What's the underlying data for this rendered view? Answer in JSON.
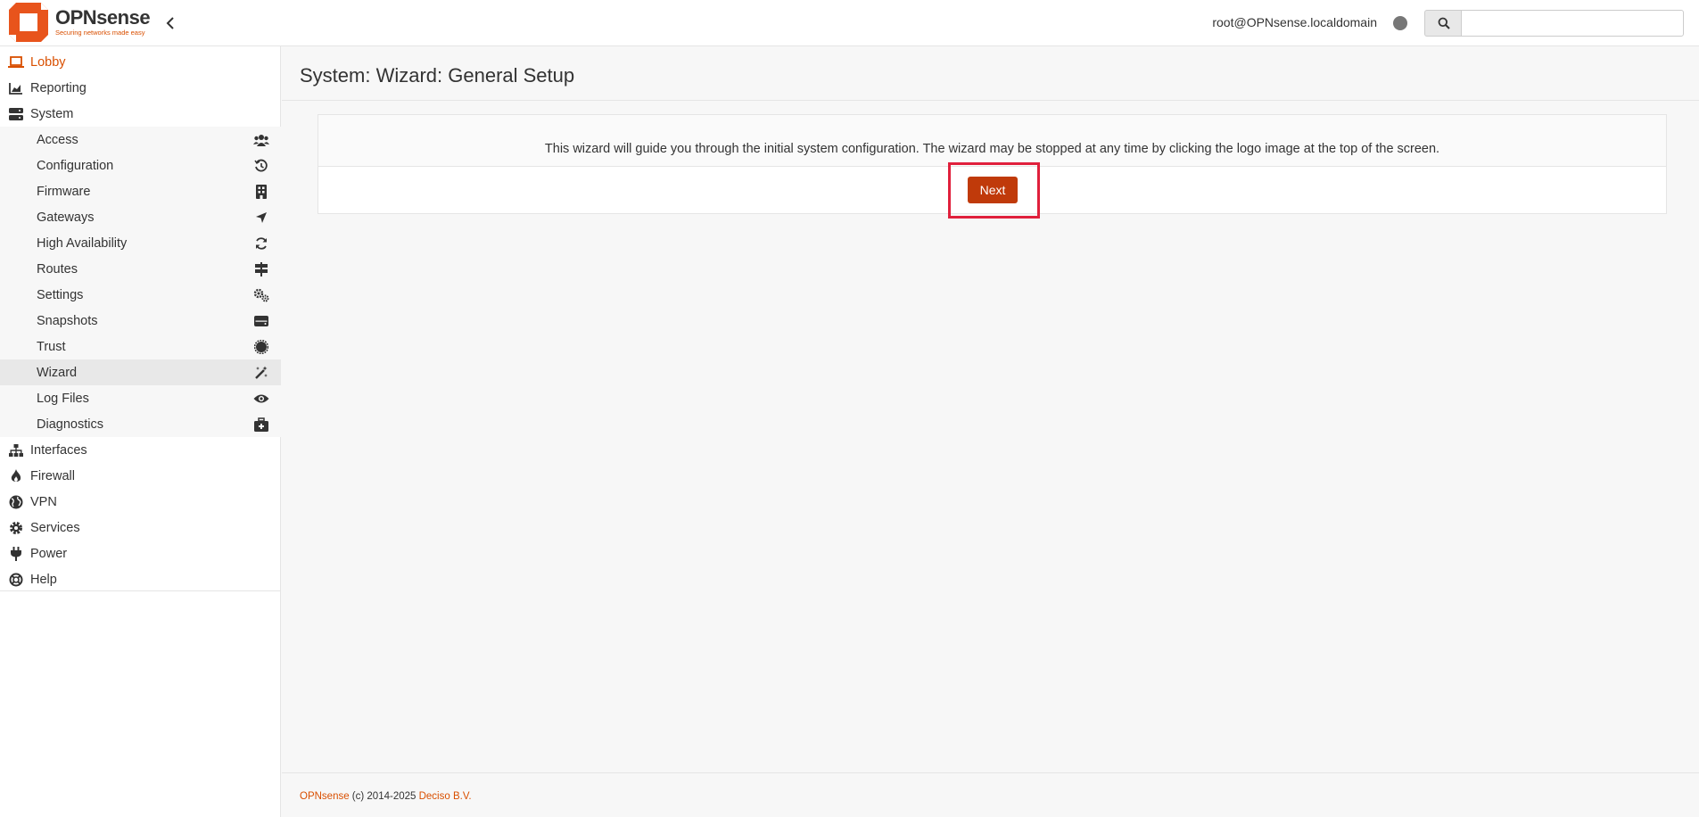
{
  "header": {
    "logo_name": "OPNsense",
    "logo_tagline": "Securing networks made easy",
    "user": "root@OPNsense.localdomain",
    "search_placeholder": ""
  },
  "sidebar": {
    "items": [
      {
        "label": "Lobby",
        "icon": "laptop-icon",
        "active": true
      },
      {
        "label": "Reporting",
        "icon": "area-chart-icon"
      },
      {
        "label": "System",
        "icon": "server-icon"
      },
      {
        "label": "Interfaces",
        "icon": "sitemap-icon"
      },
      {
        "label": "Firewall",
        "icon": "fire-icon"
      },
      {
        "label": "VPN",
        "icon": "globe-icon"
      },
      {
        "label": "Services",
        "icon": "gear-icon"
      },
      {
        "label": "Power",
        "icon": "plug-icon"
      },
      {
        "label": "Help",
        "icon": "life-ring-icon"
      }
    ],
    "system_sub": [
      {
        "label": "Access",
        "icon": "users-icon"
      },
      {
        "label": "Configuration",
        "icon": "history-icon"
      },
      {
        "label": "Firmware",
        "icon": "building-icon"
      },
      {
        "label": "Gateways",
        "icon": "location-arrow-icon"
      },
      {
        "label": "High Availability",
        "icon": "refresh-icon"
      },
      {
        "label": "Routes",
        "icon": "signpost-icon"
      },
      {
        "label": "Settings",
        "icon": "gears-icon"
      },
      {
        "label": "Snapshots",
        "icon": "hdd-icon"
      },
      {
        "label": "Trust",
        "icon": "certificate-icon"
      },
      {
        "label": "Wizard",
        "icon": "magic-wand-icon",
        "selected": true
      },
      {
        "label": "Log Files",
        "icon": "eye-icon"
      },
      {
        "label": "Diagnostics",
        "icon": "medkit-icon"
      }
    ]
  },
  "main": {
    "title": "System: Wizard: General Setup",
    "description": "This wizard will guide you through the initial system configuration. The wizard may be stopped at any time by clicking the logo image at the top of the screen.",
    "next_label": "Next"
  },
  "footer": {
    "brand": "OPNsense",
    "copyright": " (c) 2014-2025 ",
    "company": "Deciso B.V."
  },
  "colors": {
    "accent": "#d94f00",
    "button": "#c03a0a",
    "highlight": "#e0203c"
  }
}
